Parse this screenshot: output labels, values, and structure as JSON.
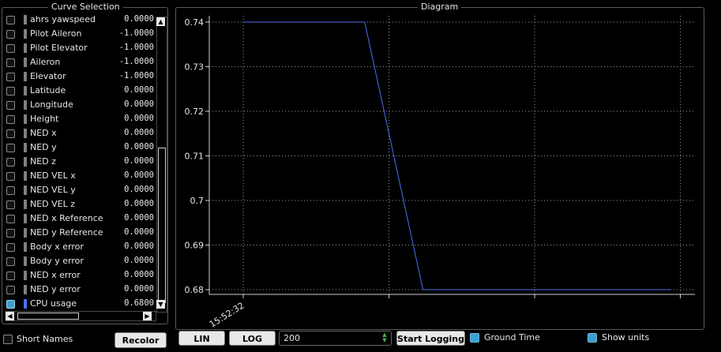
{
  "curve_selection": {
    "title": "Curve Selection",
    "items": [
      {
        "name": "ahrs yawspeed",
        "value": "0.0000",
        "checked": false,
        "color": "#808080"
      },
      {
        "name": "Pilot Aileron",
        "value": "-1.0000",
        "checked": false,
        "color": "#808080"
      },
      {
        "name": "Pilot Elevator",
        "value": "-1.0000",
        "checked": false,
        "color": "#808080"
      },
      {
        "name": "Aileron",
        "value": "-1.0000",
        "checked": false,
        "color": "#808080"
      },
      {
        "name": "Elevator",
        "value": "-1.0000",
        "checked": false,
        "color": "#808080"
      },
      {
        "name": "Latitude",
        "value": "0.0000",
        "checked": false,
        "color": "#808080"
      },
      {
        "name": "Longitude",
        "value": "0.0000",
        "checked": false,
        "color": "#808080"
      },
      {
        "name": "Height",
        "value": "0.0000",
        "checked": false,
        "color": "#808080"
      },
      {
        "name": "NED x",
        "value": "0.0000",
        "checked": false,
        "color": "#808080"
      },
      {
        "name": "NED y",
        "value": "0.0000",
        "checked": false,
        "color": "#808080"
      },
      {
        "name": "NED z",
        "value": "0.0000",
        "checked": false,
        "color": "#808080"
      },
      {
        "name": "NED VEL x",
        "value": "0.0000",
        "checked": false,
        "color": "#808080"
      },
      {
        "name": "NED VEL y",
        "value": "0.0000",
        "checked": false,
        "color": "#808080"
      },
      {
        "name": "NED VEL z",
        "value": "0.0000",
        "checked": false,
        "color": "#808080"
      },
      {
        "name": "NED x Reference",
        "value": "0.0000",
        "checked": false,
        "color": "#808080"
      },
      {
        "name": "NED y Reference",
        "value": "0.0000",
        "checked": false,
        "color": "#808080"
      },
      {
        "name": "Body x error",
        "value": "0.0000",
        "checked": false,
        "color": "#808080"
      },
      {
        "name": "Body y error",
        "value": "0.0000",
        "checked": false,
        "color": "#808080"
      },
      {
        "name": "NED x error",
        "value": "0.0000",
        "checked": false,
        "color": "#808080"
      },
      {
        "name": "NED y error",
        "value": "0.0000",
        "checked": false,
        "color": "#808080"
      },
      {
        "name": "CPU usage",
        "value": "0.6800",
        "checked": true,
        "color": "#4c6ff0"
      }
    ],
    "short_names_label": "Short Names",
    "short_names_checked": false,
    "recolor_label": "Recolor"
  },
  "diagram": {
    "title": "Diagram",
    "lin_label": "LIN",
    "log_label": "LOG",
    "interval_value": "200",
    "start_logging_label": "Start Logging",
    "ground_time_label": "Ground Time",
    "ground_time_checked": true,
    "show_units_label": "Show units",
    "show_units_checked": true
  },
  "chart_data": {
    "type": "line",
    "title": "",
    "xlabel": "",
    "ylabel": "",
    "ylim": [
      0.68,
      0.74
    ],
    "yticks": [
      "0.74",
      "0.73",
      "0.72",
      "0.71",
      "0.7",
      "0.69",
      "0.68"
    ],
    "xticks": [
      "15:52:32"
    ],
    "grid": true,
    "series": [
      {
        "color": "#4c6ff0",
        "x": [
          0.0,
          2.5,
          3.7,
          8.8
        ],
        "values": [
          0.74,
          0.74,
          0.68,
          0.68
        ]
      }
    ],
    "xlim": [
      -0.7,
      9.3
    ]
  }
}
